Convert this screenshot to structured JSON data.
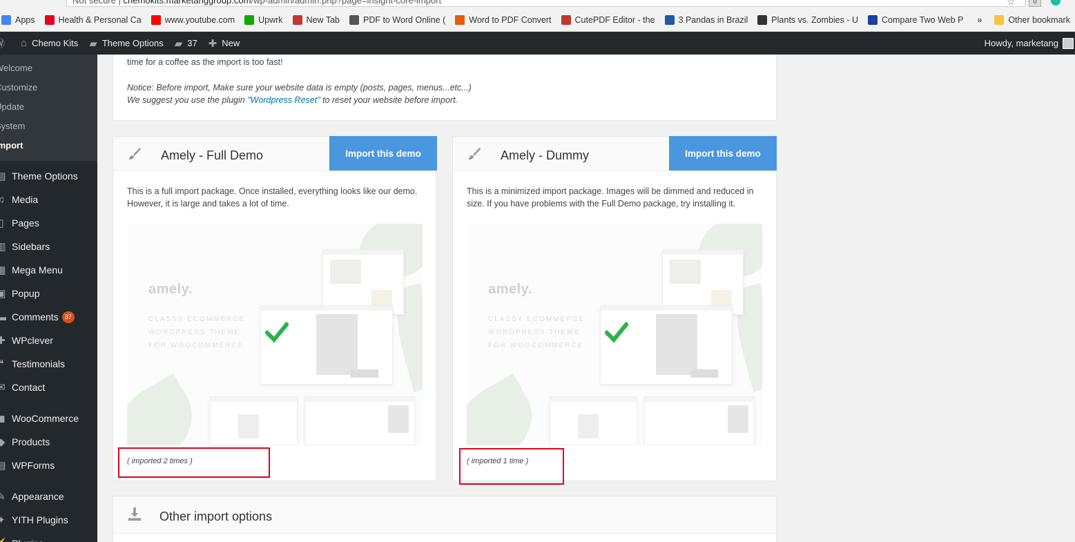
{
  "browser": {
    "security_label": "Not secure",
    "url_host": "chemokits.marketanggroup.com",
    "url_path": "/wp-admin/admin.php?page=insight-core-import",
    "extension_badge": "0",
    "bookmarks": [
      {
        "label": "Apps",
        "icon": "apps-grid-icon",
        "color": "#4285f4"
      },
      {
        "label": "Health & Personal Ca",
        "icon": "pinterest-icon",
        "color": "#e60023"
      },
      {
        "label": "www.youtube.com",
        "icon": "youtube-icon",
        "color": "#ff0000"
      },
      {
        "label": "Upwrk",
        "icon": "upwork-icon",
        "color": "#14a800"
      },
      {
        "label": "New Tab",
        "icon": "newtab-icon",
        "color": "#c0392b"
      },
      {
        "label": "PDF to Word Online (",
        "icon": "pdf-icon",
        "color": "#555555"
      },
      {
        "label": "Word to PDF Convert",
        "icon": "flame-icon",
        "color": "#e8590c"
      },
      {
        "label": "CutePDF Editor - the",
        "icon": "cutepdf-icon",
        "color": "#c0392b"
      },
      {
        "label": "3 Pandas in Brazil",
        "icon": "p-icon",
        "color": "#1e5aa8"
      },
      {
        "label": "Plants vs. Zombies - U",
        "icon": "pvz-icon",
        "color": "#333333"
      },
      {
        "label": "Compare Two Web P",
        "icon": "c-icon",
        "color": "#1a3fa0"
      }
    ],
    "more_label": "»",
    "other_bookmarks": "Other bookmark"
  },
  "adminbar": {
    "site_name": "Chemo Kits",
    "theme_options": "Theme Options",
    "comments_count": "37",
    "new_label": "New",
    "howdy": "Howdy, marketang"
  },
  "sidebar": {
    "submenu": [
      "Welcome",
      "Customize",
      "Update",
      "System",
      "Import"
    ],
    "items": [
      {
        "label": "Theme Options",
        "icon": "folder-icon",
        "glyph": "▤"
      },
      {
        "label": "Media",
        "icon": "media-icon",
        "glyph": "♫"
      },
      {
        "label": "Pages",
        "icon": "pages-icon",
        "glyph": "▯"
      },
      {
        "label": "Sidebars",
        "icon": "sidebars-icon",
        "glyph": "▥"
      },
      {
        "label": "Mega Menu",
        "icon": "megamenu-icon",
        "glyph": "▦"
      },
      {
        "label": "Popup",
        "icon": "popup-icon",
        "glyph": "▣"
      },
      {
        "label": "Comments",
        "icon": "comments-icon",
        "glyph": "▬",
        "badge": "37"
      },
      {
        "label": "WPclever",
        "icon": "wpclever-icon",
        "glyph": "✚"
      },
      {
        "label": "Testimonials",
        "icon": "testimonials-icon",
        "glyph": "❝"
      },
      {
        "label": "Contact",
        "icon": "contact-icon",
        "glyph": "✉"
      },
      {
        "label": "WooCommerce",
        "icon": "woocommerce-icon",
        "glyph": "◼"
      },
      {
        "label": "Products",
        "icon": "products-icon",
        "glyph": "◆"
      },
      {
        "label": "WPForms",
        "icon": "wpforms-icon",
        "glyph": "▤"
      },
      {
        "label": "Appearance",
        "icon": "appearance-icon",
        "glyph": "✎"
      },
      {
        "label": "YITH Plugins",
        "icon": "yith-icon",
        "glyph": "✦"
      },
      {
        "label": "Plugins",
        "icon": "plugins-icon",
        "glyph": "⚡"
      }
    ]
  },
  "top_panel": {
    "line1": "time for a coffee as the import is too fast!",
    "notice1": "Notice: Before import, Make sure your website data is empty (posts, pages, menus...etc...)",
    "notice2_pre": "We suggest you use the plugin ",
    "notice2_link": "\"Wordpress Reset\"",
    "notice2_post": " to reset your website before import."
  },
  "demos": [
    {
      "title": "Amely - Full Demo",
      "button": "Import this demo",
      "description": "This is a full import package. Once installed, everything looks like our demo. However, it is large and takes a lot of time.",
      "preview_brand": "amely.",
      "preview_tagline": [
        "CLASSY ECOMMERCE",
        "WORDPRESS THEME",
        "FOR WOOCOMMERCE"
      ],
      "imported": "( imported 2 times )"
    },
    {
      "title": "Amely - Dummy",
      "button": "Import this demo",
      "description": "This is a minimized import package. Images will be dimmed and reduced in size. If you have problems with the Full Demo package, try installing it.",
      "preview_brand": "amely.",
      "preview_tagline": [
        "CLASSY ECOMMERCE",
        "WORDPRESS THEME",
        "FOR WOOCOMMERCE"
      ],
      "imported": "( imported 1 time )"
    }
  ],
  "other_import": {
    "title": "Other import options"
  },
  "colors": {
    "admin_bg": "#23282d",
    "button_blue": "#4a97e0",
    "highlight_red": "#e0001b",
    "check_green": "#2bb24c"
  }
}
